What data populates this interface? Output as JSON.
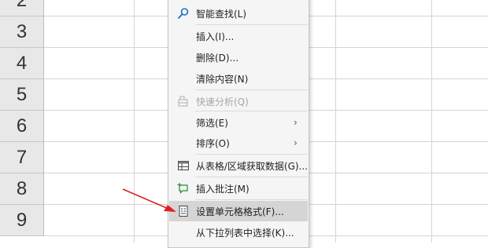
{
  "rows": [
    "2",
    "3",
    "4",
    "5",
    "6",
    "7",
    "8",
    "9"
  ],
  "menu": {
    "items": [
      {
        "label": "智能查找(L)",
        "icon": "search-icon",
        "disabled": false,
        "submenu": false
      },
      {
        "label": "插入(I)...",
        "icon": "",
        "disabled": false,
        "submenu": false
      },
      {
        "label": "删除(D)...",
        "icon": "",
        "disabled": false,
        "submenu": false
      },
      {
        "label": "清除内容(N)",
        "icon": "",
        "disabled": false,
        "submenu": false
      },
      {
        "label": "快速分析(Q)",
        "icon": "quick-analysis-icon",
        "disabled": true,
        "submenu": false
      },
      {
        "label": "筛选(E)",
        "icon": "",
        "disabled": false,
        "submenu": true
      },
      {
        "label": "排序(O)",
        "icon": "",
        "disabled": false,
        "submenu": true
      },
      {
        "label": "从表格/区域获取数据(G)...",
        "icon": "table-icon",
        "disabled": false,
        "submenu": false
      },
      {
        "label": "插入批注(M)",
        "icon": "comment-icon",
        "disabled": false,
        "submenu": false
      },
      {
        "label": "设置单元格格式(F)...",
        "icon": "format-cells-icon",
        "disabled": false,
        "submenu": false,
        "highlighted": true
      },
      {
        "label": "从下拉列表中选择(K)...",
        "icon": "",
        "disabled": false,
        "submenu": false
      }
    ],
    "submenu_glyph": "›"
  },
  "colors": {
    "highlight": "#d5d5d5",
    "arrow": "#e02020",
    "icon_blue": "#1f6fc0"
  }
}
